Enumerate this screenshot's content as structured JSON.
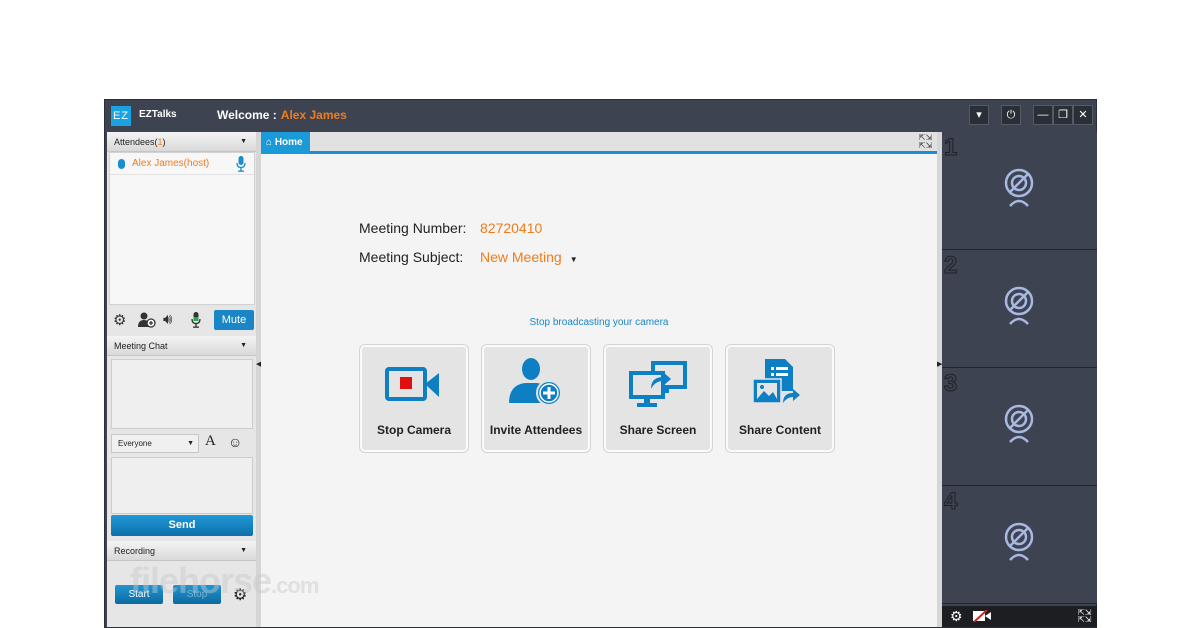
{
  "titlebar": {
    "logo": "EZ",
    "app_name": "EZTalks",
    "welcome_label": "Welcome :",
    "user_name": "Alex James",
    "buttons": {
      "menu": "▾",
      "power": "⏻",
      "minimize": "—",
      "restore": "❐",
      "close": "✕"
    }
  },
  "sidebar": {
    "attendees_header": "Attendees(",
    "attendees_count": "1",
    "attendees_close": ")",
    "attendees": [
      {
        "name": "Alex James(host)"
      }
    ],
    "mute_label": "Mute",
    "chat_header": "Meeting Chat",
    "chat_target": "Everyone",
    "font_icon": "A",
    "send_label": "Send",
    "recording_header": "Recording",
    "start_label": "Start",
    "stop_label": "Stop"
  },
  "main": {
    "tab_home": "Home",
    "meeting_number_label": "Meeting Number:",
    "meeting_number": "82720410",
    "meeting_subject_label": "Meeting Subject:",
    "meeting_subject": "New Meeting",
    "hint": "Stop broadcasting your camera",
    "actions": [
      {
        "label": "Stop Camera"
      },
      {
        "label": "Invite Attendees"
      },
      {
        "label": "Share Screen"
      },
      {
        "label": "Share Content"
      }
    ]
  },
  "videos": {
    "slots": [
      {
        "number": "1"
      },
      {
        "number": "2"
      },
      {
        "number": "3"
      },
      {
        "number": "4"
      }
    ]
  },
  "watermark": {
    "text": "filehorse",
    "suffix": ".com"
  },
  "colors": {
    "accent": "#1a8ed0",
    "highlight": "#f07c1c",
    "titlebar": "#3d4350"
  }
}
